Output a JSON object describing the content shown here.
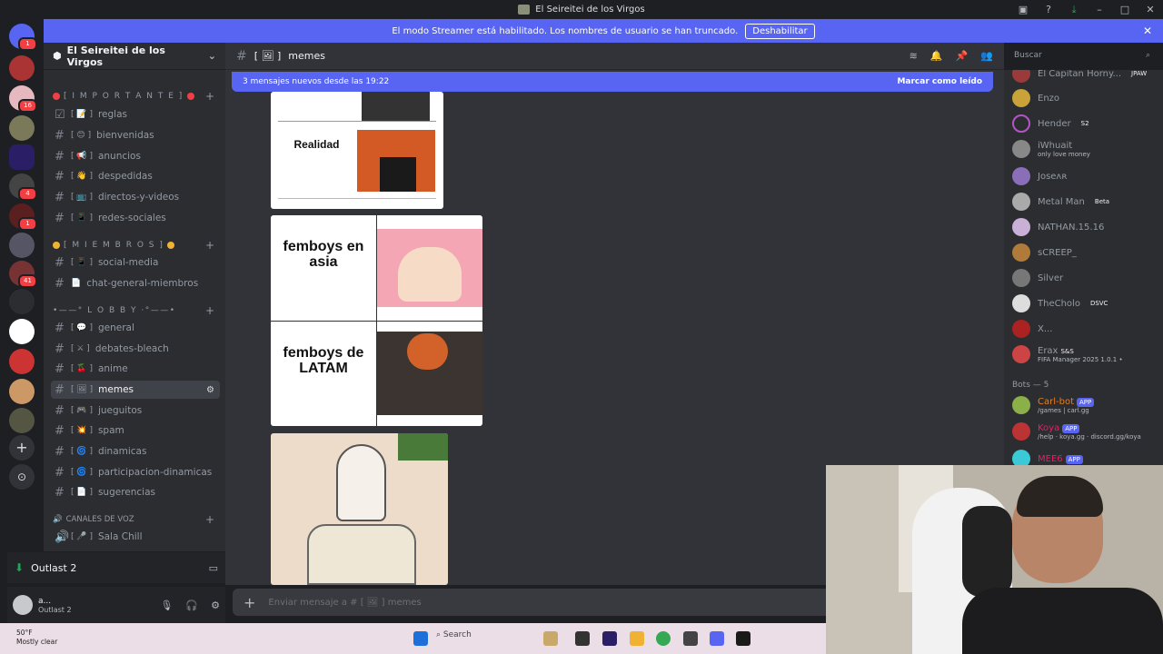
{
  "window": {
    "title": "El Seireitei de los Virgos"
  },
  "banner": {
    "text": "El modo Streamer está habilitado. Los nombres de usuario se han truncado.",
    "button": "Deshabilitar"
  },
  "server": {
    "name": "El Seireitei de los Virgos"
  },
  "categories": [
    {
      "label": "[ I M P O R T A N T E ]",
      "color": "#f23f43"
    },
    {
      "label": "[ M I E M B R O S ]",
      "color": "#f0b232"
    },
    {
      "label": "•——° L O B B Y ·°——•",
      "color": "#f0b232"
    },
    {
      "label": "CANALES DE VOZ",
      "color": "#949ba4"
    }
  ],
  "channels": [
    {
      "prefix": "[ 📝 ]",
      "name": "reglas"
    },
    {
      "prefix": "[ 😊 ]",
      "name": "bienvenidas"
    },
    {
      "prefix": "[ 📢 ]",
      "name": "anuncios"
    },
    {
      "prefix": "[ 👋 ]",
      "name": "despedidas"
    },
    {
      "prefix": "[ 📺 ]",
      "name": "directos-y-videos"
    },
    {
      "prefix": "[ 📱 ]",
      "name": "redes-sociales"
    },
    {
      "prefix": "[ 📱 ]",
      "name": "social-media"
    },
    {
      "prefix": "📄",
      "name": "chat-general-miembros"
    },
    {
      "prefix": "[ 💬 ]",
      "name": "general"
    },
    {
      "prefix": "[ ⚔ ]",
      "name": "debates-bleach"
    },
    {
      "prefix": "[ 🍒 ]",
      "name": "anime"
    },
    {
      "prefix": "[ 🖼 ]",
      "name": "memes"
    },
    {
      "prefix": "[ 🎮 ]",
      "name": "jueguitos"
    },
    {
      "prefix": "[ 💥 ]",
      "name": "spam"
    },
    {
      "prefix": "[ 🌀 ]",
      "name": "dinamicas"
    },
    {
      "prefix": "[ 🌀 ]",
      "name": "participacion-dinamicas"
    },
    {
      "prefix": "[ 📄 ]",
      "name": "sugerencias"
    },
    {
      "prefix": "[ 🎤 ]",
      "name": "Sala Chill"
    }
  ],
  "voice": {
    "activity": "Outlast 2"
  },
  "user": {
    "name": "a...",
    "status": "Outlast 2"
  },
  "topbar": {
    "channel_prefix": "[ 🖼 ]",
    "channel": "memes"
  },
  "search": {
    "placeholder": "Buscar"
  },
  "new_messages": {
    "text": "3 mensajes nuevos desde las 19:22",
    "action": "Marcar como leído"
  },
  "memes": [
    {
      "top_text": "Realidad"
    },
    {
      "top_text": "femboys en asia",
      "bottom_text": "femboys de LATAM"
    }
  ],
  "composer": {
    "placeholder": "Enviar mensaje a # [ 🖼 ] memes"
  },
  "members": [
    {
      "name": "El Capitan Horny...",
      "tag": "JPAW",
      "color": "#949ba4"
    },
    {
      "name": "Enzo",
      "color": "#949ba4"
    },
    {
      "name": "Hender",
      "tag": "S2",
      "color": "#949ba4"
    },
    {
      "name": "iWhuait",
      "sub": "only love money",
      "color": "#949ba4"
    },
    {
      "name": "Joseʌʀ",
      "color": "#949ba4"
    },
    {
      "name": "Metal Man",
      "tag": "Beta",
      "color": "#949ba4"
    },
    {
      "name": "NATHAN.15.16",
      "color": "#949ba4"
    },
    {
      "name": "sCREEP_",
      "color": "#949ba4"
    },
    {
      "name": "Silver",
      "color": "#949ba4"
    },
    {
      "name": "TheCholo",
      "tag": "DSVC",
      "color": "#949ba4"
    },
    {
      "name": "X...",
      "color": "#949ba4"
    },
    {
      "name": "Erax",
      "tag": "S&S",
      "sub": "FIFA Manager 2025 1.0.1 •",
      "color": "#949ba4"
    }
  ],
  "bots_header": "Bots — 5",
  "bots": [
    {
      "name": "Carl-bot",
      "tag": "APP",
      "sub": "/games | carl.gg",
      "color": "#e67e22"
    },
    {
      "name": "Koya",
      "tag": "APP",
      "sub": "/help · koya.gg · discord.gg/koya",
      "color": "#e91e63"
    },
    {
      "name": "MEE6",
      "tag": "APP",
      "sub": "",
      "color": "#e91e63"
    }
  ],
  "taskbar": {
    "weather_temp": "50°F",
    "weather_desc": "Mostly clear",
    "search": "Search"
  },
  "colors": {
    "accent": "#5865f2",
    "bg": "#313338",
    "sidebar": "#2b2d31"
  }
}
